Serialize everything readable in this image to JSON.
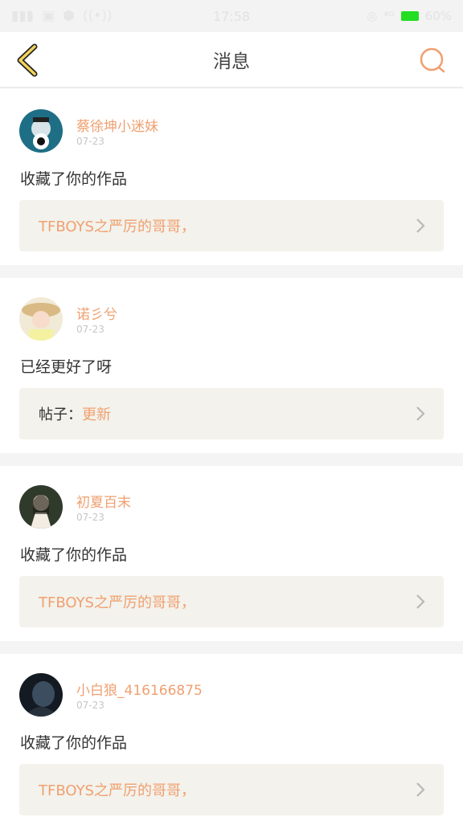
{
  "status_bar": {
    "time": "17:58",
    "battery": "60%"
  },
  "header": {
    "title": "消息",
    "back_icon": "chevron-left-icon",
    "search_icon": "search-icon"
  },
  "messages": [
    {
      "username": "蔡徐坤小迷妹",
      "date": "07-23",
      "text": "收藏了你的作品",
      "ref_prefix": "",
      "ref_text": "TFBOYS之严厉的哥哥，"
    },
    {
      "username": "诺彡兮",
      "date": "07-23",
      "text": "已经更好了呀",
      "ref_prefix": "帖子：",
      "ref_text": "更新"
    },
    {
      "username": "初夏百末",
      "date": "07-23",
      "text": "收藏了你的作品",
      "ref_prefix": "",
      "ref_text": "TFBOYS之严厉的哥哥，"
    },
    {
      "username": "小白狼_416166875",
      "date": "07-23",
      "text": "收藏了你的作品",
      "ref_prefix": "",
      "ref_text": "TFBOYS之严厉的哥哥，"
    }
  ],
  "colors": {
    "accent": "#f0a070",
    "ref_bg": "#f3f2ec",
    "separator": "#f4f4f4"
  }
}
